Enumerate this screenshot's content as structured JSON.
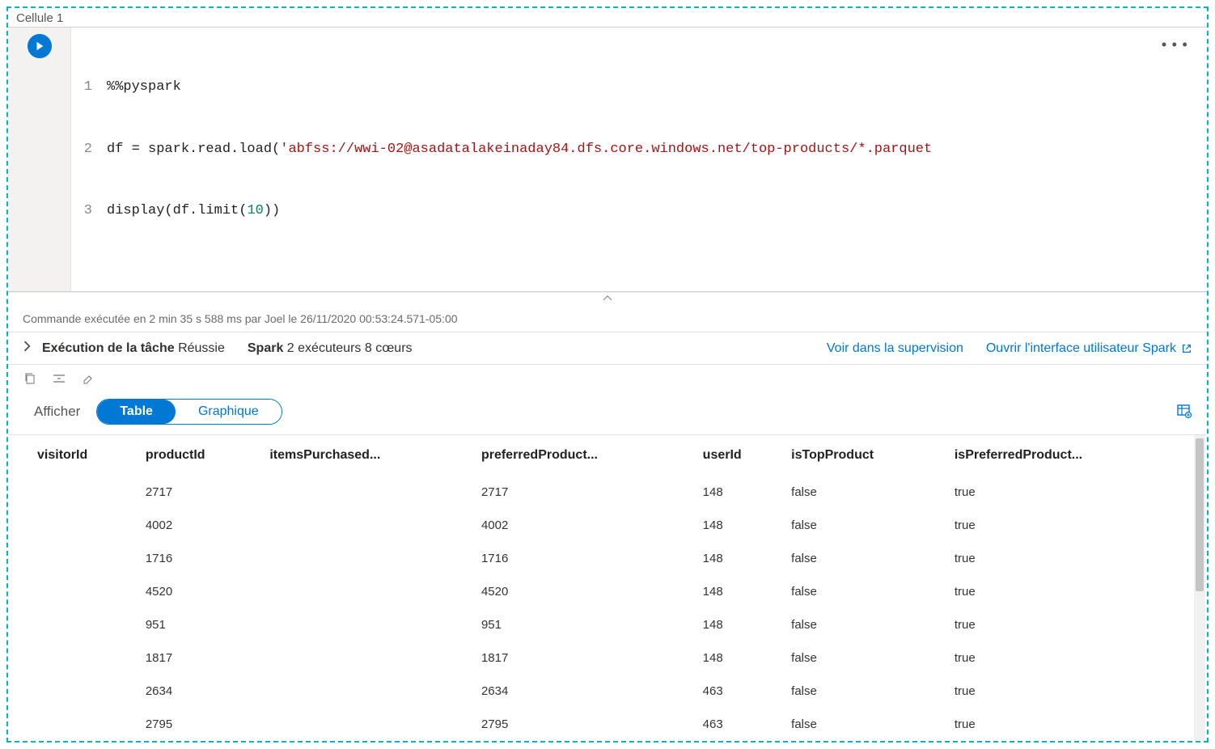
{
  "cell": {
    "label": "Cellule 1"
  },
  "code": {
    "lines": [
      {
        "n": "1",
        "plain": "%%pyspark"
      },
      {
        "n": "2",
        "prefix": "df = spark.read.load(",
        "string": "'abfss://wwi-02@asadatalakeinaday84.dfs.core.windows.net/top-products/*.parquet",
        "suffix": ""
      },
      {
        "n": "3",
        "prefix": "display(df.limit(",
        "number": "10",
        "suffix": "))"
      }
    ]
  },
  "status": "Commande exécutée en 2 min 35 s 588 ms par Joel le 26/11/2020 00:53:24.571-05:00",
  "exec": {
    "job_label": "Exécution de la tâche",
    "job_status": "Réussie",
    "spark_label": "Spark",
    "spark_detail": "2 exécuteurs 8 cœurs",
    "link_monitor": "Voir dans la supervision",
    "link_spark_ui": "Ouvrir l'interface utilisateur Spark"
  },
  "view": {
    "label": "Afficher",
    "tab_table": "Table",
    "tab_chart": "Graphique"
  },
  "table": {
    "columns": [
      "visitorId",
      "productId",
      "itemsPurchased...",
      "preferredProduct...",
      "userId",
      "isTopProduct",
      "isPreferredProduct..."
    ],
    "rows": [
      [
        "",
        "2717",
        "",
        "2717",
        "148",
        "false",
        "true"
      ],
      [
        "",
        "4002",
        "",
        "4002",
        "148",
        "false",
        "true"
      ],
      [
        "",
        "1716",
        "",
        "1716",
        "148",
        "false",
        "true"
      ],
      [
        "",
        "4520",
        "",
        "4520",
        "148",
        "false",
        "true"
      ],
      [
        "",
        "951",
        "",
        "951",
        "148",
        "false",
        "true"
      ],
      [
        "",
        "1817",
        "",
        "1817",
        "148",
        "false",
        "true"
      ],
      [
        "",
        "2634",
        "",
        "2634",
        "463",
        "false",
        "true"
      ],
      [
        "",
        "2795",
        "",
        "2795",
        "463",
        "false",
        "true"
      ]
    ]
  }
}
